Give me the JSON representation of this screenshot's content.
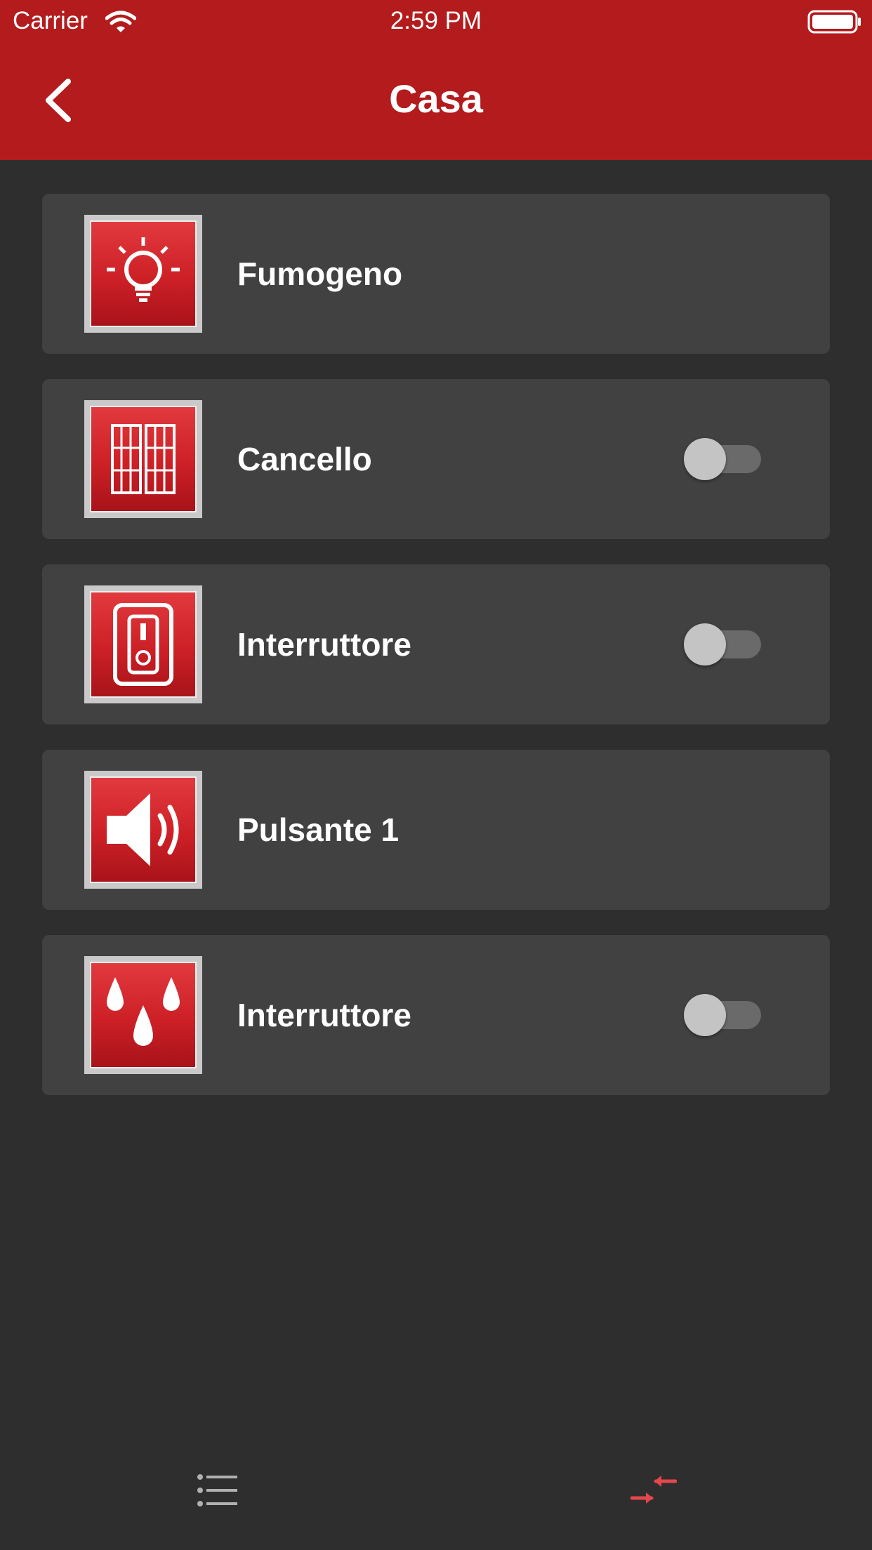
{
  "status_bar": {
    "carrier": "Carrier",
    "time": "2:59 PM"
  },
  "header": {
    "title": "Casa",
    "back_icon": "chevron-left-icon"
  },
  "colors": {
    "header_bg": "#b31b1d",
    "page_bg": "#2e2e2e",
    "card_bg": "#414141",
    "active_tab": "#e5474c"
  },
  "devices": [
    {
      "label": "Fumogeno",
      "icon": "light-bulb-icon",
      "toggle": null
    },
    {
      "label": "Cancello",
      "icon": "gate-icon",
      "toggle": "off"
    },
    {
      "label": "Interruttore",
      "icon": "switch-icon",
      "toggle": "off"
    },
    {
      "label": "Pulsante 1",
      "icon": "speaker-icon",
      "toggle": null
    },
    {
      "label": "Interruttore",
      "icon": "water-drops-icon",
      "toggle": "off"
    }
  ],
  "tab_bar": {
    "tabs": [
      {
        "icon": "list-icon",
        "active": false
      },
      {
        "icon": "compact-arrows-icon",
        "active": true
      }
    ]
  }
}
